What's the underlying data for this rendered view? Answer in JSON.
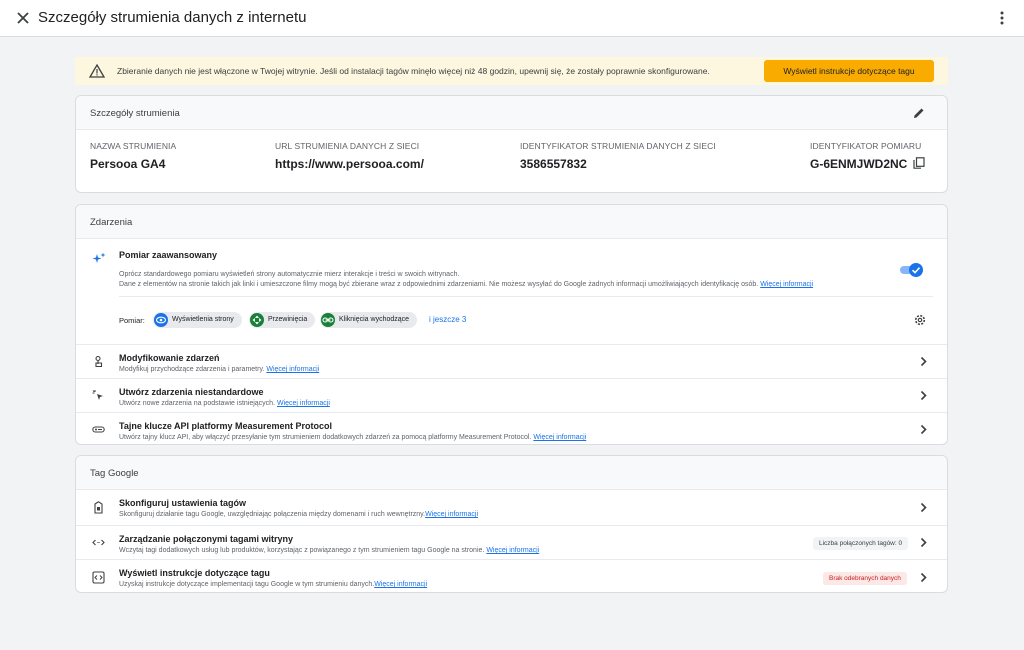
{
  "header": {
    "title": "Szczegóły strumienia danych z internetu",
    "close_icon": "close-icon",
    "more_icon": "more-vert-icon"
  },
  "banner": {
    "message": "Zbieranie danych nie jest włączone w Twojej witrynie. Jeśli od instalacji tagów minęło więcej niż 48 godzin, upewnij się, że zostały poprawnie skonfigurowane.",
    "button": "Wyświetl instrukcje dotyczące tagu",
    "accent": "#f9ab00"
  },
  "stream": {
    "heading": "Szczegóły strumienia",
    "name_label": "NAZWA STRUMIENIA",
    "name": "Persooa GA4",
    "url_label": "URL STRUMIENIA DANYCH Z SIECI",
    "url": "https://www.persooa.com/",
    "id_label": "IDENTYFIKATOR STRUMIENIA DANYCH Z SIECI",
    "id": "3586557832",
    "measurement_label": "IDENTYFIKATOR POMIARU",
    "measurement_id": "G-6ENMJWD2NC"
  },
  "events": {
    "heading": "Zdarzenia",
    "enhanced": {
      "title": "Pomiar zaawansowany",
      "desc1": "Oprócz standardowego pomiaru wyświetleń strony automatycznie mierz interakcje i treści w swoich witrynach.",
      "desc2": "Dane z elementów na stronie takich jak linki i umieszczone filmy mogą być zbierane wraz z odpowiednimi zdarzeniami. Nie możesz wysyłać do Google żadnych informacji umożliwiających identyfikację osób.",
      "link": "Więcej informacji",
      "measure_label": "Pomiar:",
      "chips": [
        "Wyświetlenia strony",
        "Przewinięcia",
        "Kliknięcia wychodzące"
      ],
      "more": "i jeszcze 3",
      "enabled": true
    },
    "items": [
      {
        "title": "Modyfikowanie zdarzeń",
        "desc": "Modyfikuj przychodzące zdarzenia i parametry.",
        "link": "Więcej informacji"
      },
      {
        "title": "Utwórz zdarzenia niestandardowe",
        "desc": "Utwórz nowe zdarzenia na podstawie istniejących.",
        "link": "Więcej informacji"
      },
      {
        "title": "Tajne klucze API platformy Measurement Protocol",
        "desc": "Utwórz tajny klucz API, aby włączyć przesyłanie tym strumieniem dodatkowych zdarzeń za pomocą platformy Measurement Protocol.",
        "link": "Więcej informacji"
      }
    ]
  },
  "tag": {
    "heading": "Tag Google",
    "items": [
      {
        "title": "Skonfiguruj ustawienia tagów",
        "desc": "Skonfiguruj działanie tagu Google, uwzględniając połączenia między domenami i ruch wewnętrzny.",
        "link": "Więcej informacji"
      },
      {
        "title": "Zarządzanie połączonymi tagami witryny",
        "desc": "Wczytaj tagi dodatkowych usług lub produktów, korzystając z powiązanego z tym strumieniem tagu Google na stronie.",
        "link": "Więcej informacji",
        "badge": "Liczba połączonych tagów: 0"
      },
      {
        "title": "Wyświetl instrukcje dotyczące tagu",
        "desc": "Uzyskaj instrukcje dotyczące implementacji tagu Google w tym strumieniu danych.",
        "link": "Więcej informacji",
        "badge": "Brak odebranych danych"
      }
    ]
  }
}
